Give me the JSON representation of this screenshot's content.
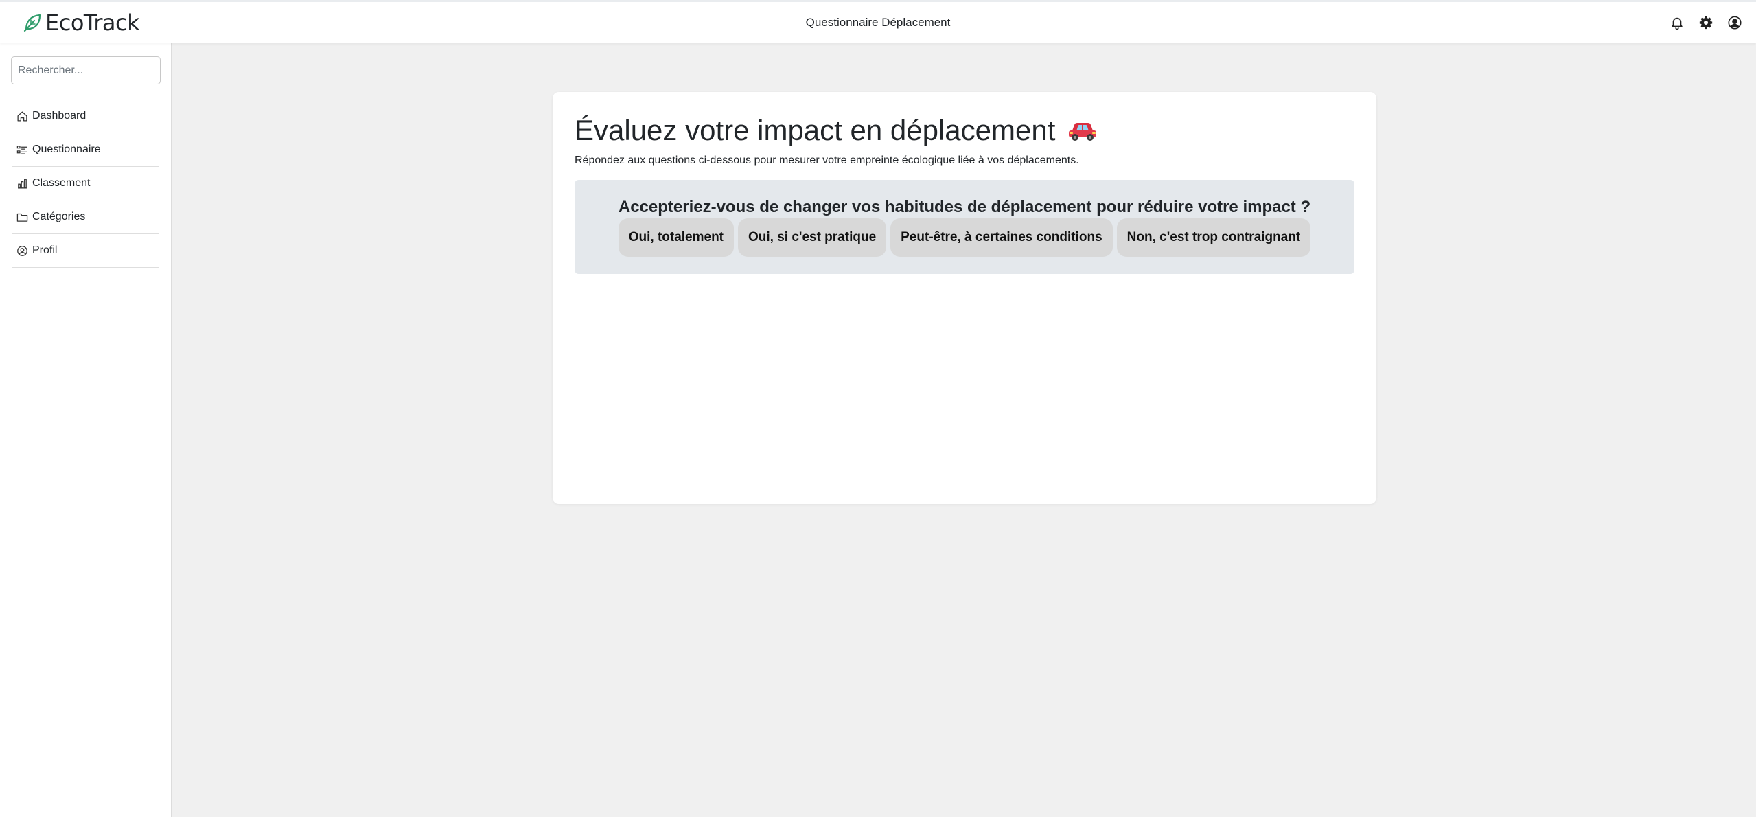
{
  "app": {
    "brand_name": "EcoTrack",
    "page_heading": "Questionnaire Déplacement",
    "accent_color": "#2e9c6a"
  },
  "header": {
    "icons": [
      "bell-icon",
      "gear-icon",
      "user-circle-icon"
    ]
  },
  "sidebar": {
    "search_placeholder": "Rechercher...",
    "items": [
      {
        "label": "Dashboard",
        "icon": "home-icon"
      },
      {
        "label": "Questionnaire",
        "icon": "list-icon"
      },
      {
        "label": "Classement",
        "icon": "bar-chart-icon"
      },
      {
        "label": "Catégories",
        "icon": "folder-icon"
      },
      {
        "label": "Profil",
        "icon": "user-circle-icon"
      }
    ]
  },
  "main": {
    "title": "Évaluez votre impact en déplacement",
    "title_icon": "car-icon",
    "subtitle": "Répondez aux questions ci-dessous pour mesurer votre empreinte écologique liée à vos déplacements.",
    "question": "Accepteriez-vous de changer vos habitudes de déplacement pour réduire votre impact ?",
    "answers": [
      "Oui, totalement",
      "Oui, si c'est pratique",
      "Peut-être, à certaines conditions",
      "Non, c'est trop contraignant"
    ]
  }
}
